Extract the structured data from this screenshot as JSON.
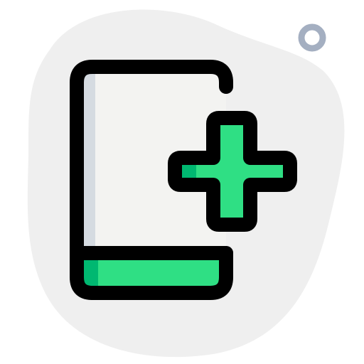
{
  "icon": {
    "name": "mobile-add-icon",
    "colors": {
      "background_blob": "#efefef",
      "phone_screen": "#f3f3f1",
      "phone_shadow": "#d5dbe1",
      "accent": "#2fdf84",
      "accent_shadow": "#00b871",
      "outline": "#000000",
      "decor_ring": "#a4afc1"
    }
  }
}
